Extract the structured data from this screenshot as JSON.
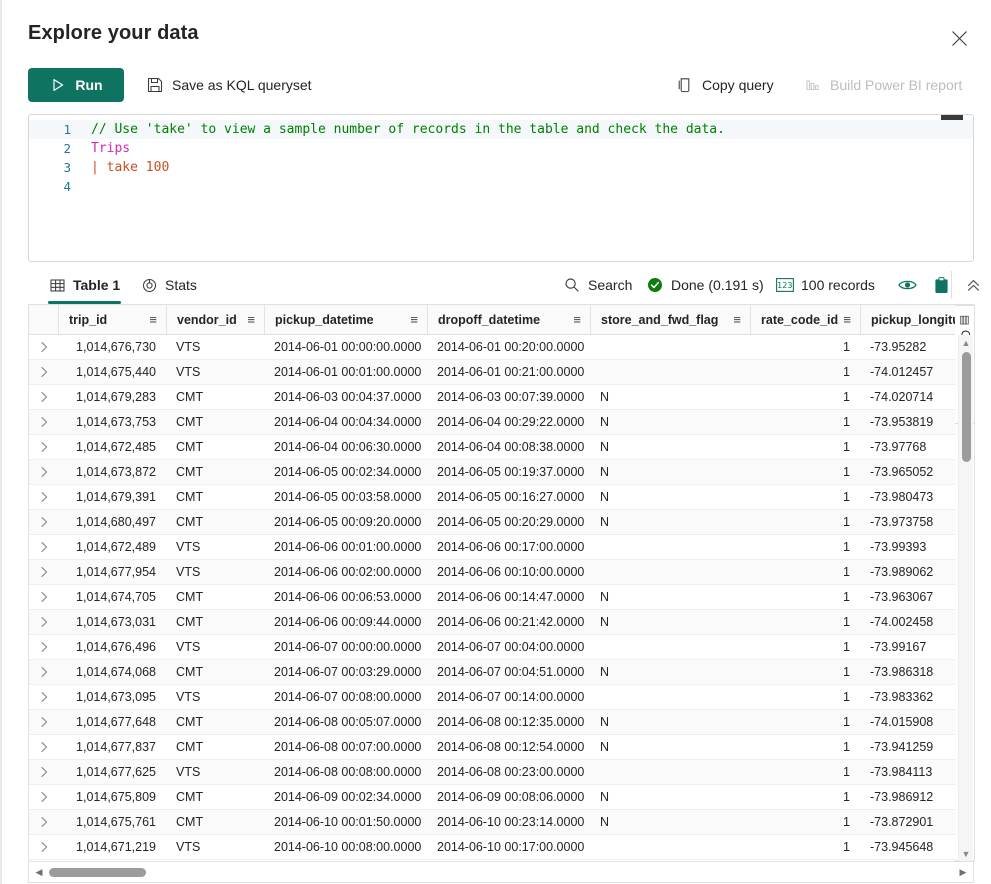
{
  "header": {
    "title": "Explore your data",
    "close_icon": "close-icon"
  },
  "toolbar": {
    "run_label": "Run",
    "run_icon": "play-icon",
    "save_label": "Save as KQL queryset",
    "save_icon": "save-disk-icon",
    "copy_label": "Copy query",
    "copy_icon": "copy-icon",
    "report_label": "Build Power BI report",
    "report_icon": "bar-chart-icon",
    "accent_color": "#0f7362"
  },
  "editor": {
    "lines": [
      {
        "num": "1",
        "segments": [
          {
            "cls": "tok-comment",
            "text": "// Use 'take' to view a sample number of records in the table and check the data."
          }
        ]
      },
      {
        "num": "2",
        "segments": [
          {
            "cls": "tok-table",
            "text": "Trips"
          }
        ]
      },
      {
        "num": "3",
        "segments": [
          {
            "cls": "tok-pipe",
            "text": "| "
          },
          {
            "cls": "tok-kw",
            "text": "take "
          },
          {
            "cls": "tok-num",
            "text": "100"
          }
        ]
      },
      {
        "num": "4",
        "segments": []
      }
    ]
  },
  "results": {
    "tabs": [
      {
        "id": "table",
        "label": "Table 1",
        "icon": "table-icon",
        "active": true
      },
      {
        "id": "stats",
        "label": "Stats",
        "icon": "stats-target-icon",
        "active": false
      }
    ],
    "search_label": "Search",
    "search_icon": "search-icon",
    "status_label": "Done (0.191 s)",
    "status_icon": "check-circle-icon",
    "status_color": "#107c10",
    "records_label": "100 records",
    "records_icon": "numeric-123-icon",
    "eye_icon": "eye-icon",
    "clipboard_icon": "clipboard-icon",
    "collapse_icon": "chevron-double-up-icon",
    "columns_rail_label": "Columns",
    "columns_rail_icon": "columns-icon"
  },
  "grid": {
    "columns": [
      {
        "key": "expander",
        "label": "",
        "cls": "exp",
        "menu": false,
        "numeric": false
      },
      {
        "key": "trip_id",
        "label": "trip_id",
        "cls": "trip",
        "menu": true,
        "numeric": true
      },
      {
        "key": "vendor_id",
        "label": "vendor_id",
        "cls": "vend",
        "menu": true,
        "numeric": false
      },
      {
        "key": "pickup_datetime",
        "label": "pickup_datetime",
        "cls": "pick",
        "menu": true,
        "numeric": false
      },
      {
        "key": "dropoff_datetime",
        "label": "dropoff_datetime",
        "cls": "drop",
        "menu": true,
        "numeric": false
      },
      {
        "key": "store_and_fwd_flag",
        "label": "store_and_fwd_flag",
        "cls": "flag",
        "menu": true,
        "numeric": false
      },
      {
        "key": "rate_code_id",
        "label": "rate_code_id",
        "cls": "rate",
        "menu": true,
        "numeric": true
      },
      {
        "key": "pickup_longitude",
        "label": "pickup_longitude",
        "cls": "long",
        "menu": false,
        "numeric": false
      }
    ],
    "expander_icon": "chevron-right-icon",
    "rows": [
      [
        "1,014,676,730",
        "VTS",
        "2014-06-01 00:00:00.0000",
        "2014-06-01 00:20:00.0000",
        "",
        "1",
        "-73.95282"
      ],
      [
        "1,014,675,440",
        "VTS",
        "2014-06-01 00:01:00.0000",
        "2014-06-01 00:21:00.0000",
        "",
        "1",
        "-74.012457"
      ],
      [
        "1,014,679,283",
        "CMT",
        "2014-06-03 00:04:37.0000",
        "2014-06-03 00:07:39.0000",
        "N",
        "1",
        "-74.020714"
      ],
      [
        "1,014,673,753",
        "CMT",
        "2014-06-04 00:04:34.0000",
        "2014-06-04 00:29:22.0000",
        "N",
        "1",
        "-73.953819"
      ],
      [
        "1,014,672,485",
        "CMT",
        "2014-06-04 00:06:30.0000",
        "2014-06-04 00:08:38.0000",
        "N",
        "1",
        "-73.97768"
      ],
      [
        "1,014,673,872",
        "CMT",
        "2014-06-05 00:02:34.0000",
        "2014-06-05 00:19:37.0000",
        "N",
        "1",
        "-73.965052"
      ],
      [
        "1,014,679,391",
        "CMT",
        "2014-06-05 00:03:58.0000",
        "2014-06-05 00:16:27.0000",
        "N",
        "1",
        "-73.980473"
      ],
      [
        "1,014,680,497",
        "CMT",
        "2014-06-05 00:09:20.0000",
        "2014-06-05 00:20:29.0000",
        "N",
        "1",
        "-73.973758"
      ],
      [
        "1,014,672,489",
        "VTS",
        "2014-06-06 00:01:00.0000",
        "2014-06-06 00:17:00.0000",
        "",
        "1",
        "-73.99393"
      ],
      [
        "1,014,677,954",
        "VTS",
        "2014-06-06 00:02:00.0000",
        "2014-06-06 00:10:00.0000",
        "",
        "1",
        "-73.989062"
      ],
      [
        "1,014,674,705",
        "CMT",
        "2014-06-06 00:06:53.0000",
        "2014-06-06 00:14:47.0000",
        "N",
        "1",
        "-73.963067"
      ],
      [
        "1,014,673,031",
        "CMT",
        "2014-06-06 00:09:44.0000",
        "2014-06-06 00:21:42.0000",
        "N",
        "1",
        "-74.002458"
      ],
      [
        "1,014,676,496",
        "VTS",
        "2014-06-07 00:00:00.0000",
        "2014-06-07 00:04:00.0000",
        "",
        "1",
        "-73.99167"
      ],
      [
        "1,014,674,068",
        "CMT",
        "2014-06-07 00:03:29.0000",
        "2014-06-07 00:04:51.0000",
        "N",
        "1",
        "-73.986318"
      ],
      [
        "1,014,673,095",
        "VTS",
        "2014-06-07 00:08:00.0000",
        "2014-06-07 00:14:00.0000",
        "",
        "1",
        "-73.983362"
      ],
      [
        "1,014,677,648",
        "CMT",
        "2014-06-08 00:05:07.0000",
        "2014-06-08 00:12:35.0000",
        "N",
        "1",
        "-74.015908"
      ],
      [
        "1,014,677,837",
        "CMT",
        "2014-06-08 00:07:00.0000",
        "2014-06-08 00:12:54.0000",
        "N",
        "1",
        "-73.941259"
      ],
      [
        "1,014,677,625",
        "VTS",
        "2014-06-08 00:08:00.0000",
        "2014-06-08 00:23:00.0000",
        "",
        "1",
        "-73.984113"
      ],
      [
        "1,014,675,809",
        "CMT",
        "2014-06-09 00:02:34.0000",
        "2014-06-09 00:08:06.0000",
        "N",
        "1",
        "-73.986912"
      ],
      [
        "1,014,675,761",
        "CMT",
        "2014-06-10 00:01:50.0000",
        "2014-06-10 00:23:14.0000",
        "N",
        "1",
        "-73.872901"
      ],
      [
        "1,014,671,219",
        "VTS",
        "2014-06-10 00:08:00.0000",
        "2014-06-10 00:17:00.0000",
        "",
        "1",
        "-73.945648"
      ]
    ]
  }
}
